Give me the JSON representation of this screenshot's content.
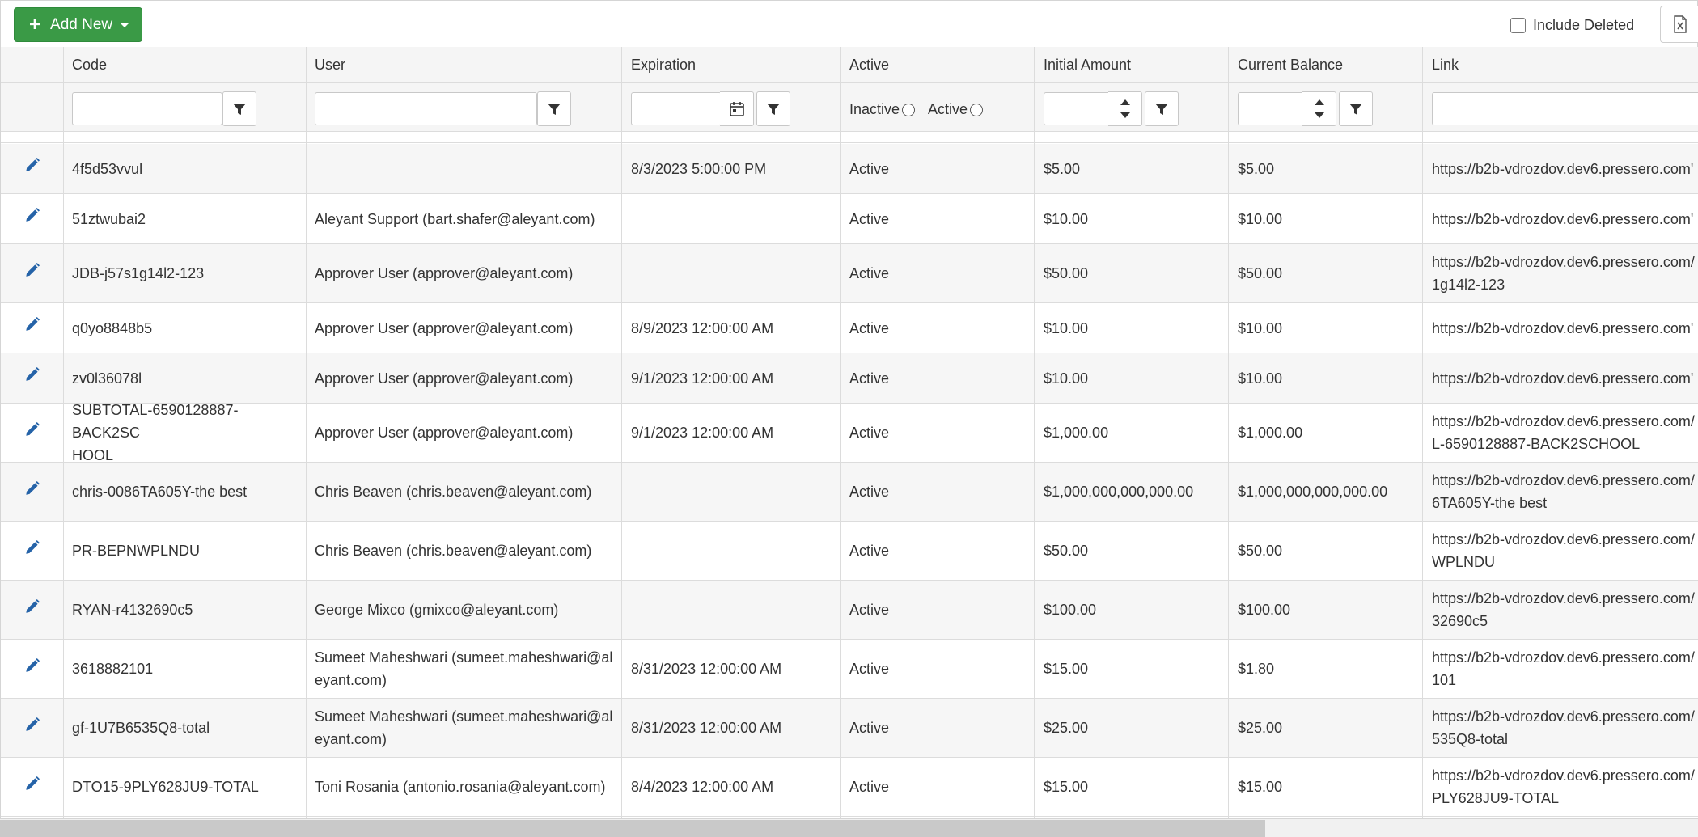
{
  "toolbar": {
    "add_new_label": "Add New",
    "include_deleted_label": "Include Deleted"
  },
  "colors": {
    "add_button": "#3a9a46",
    "pencil": "#2563a8",
    "row_alt": "#f6f6f6"
  },
  "headers": {
    "code": "Code",
    "user": "User",
    "expiration": "Expiration",
    "active": "Active",
    "initial_amount": "Initial Amount",
    "current_balance": "Current Balance",
    "link": "Link"
  },
  "filters": {
    "inactive_label": "Inactive",
    "active_label": "Active"
  },
  "rows": [
    {
      "code": "4f5d53vvul",
      "user": "",
      "expiration": "8/3/2023 5:00:00 PM",
      "active": "Active",
      "initial": "$5.00",
      "balance": "$5.00",
      "link": "https://b2b-vdrozdov.dev6.pressero.com'"
    },
    {
      "code": "51ztwubai2",
      "user": "Aleyant Support (bart.shafer@aleyant.com)",
      "expiration": "",
      "active": "Active",
      "initial": "$10.00",
      "balance": "$10.00",
      "link": "https://b2b-vdrozdov.dev6.pressero.com'"
    },
    {
      "code": "JDB-j57s1g14l2-123",
      "user": "Approver User (approver@aleyant.com)",
      "expiration": "",
      "active": "Active",
      "initial": "$50.00",
      "balance": "$50.00",
      "link": "https://b2b-vdrozdov.dev6.pressero.com/\n1g14l2-123"
    },
    {
      "code": "q0yo8848b5",
      "user": "Approver User (approver@aleyant.com)",
      "expiration": "8/9/2023 12:00:00 AM",
      "active": "Active",
      "initial": "$10.00",
      "balance": "$10.00",
      "link": "https://b2b-vdrozdov.dev6.pressero.com'"
    },
    {
      "code": "zv0l36078l",
      "user": "Approver User (approver@aleyant.com)",
      "expiration": "9/1/2023 12:00:00 AM",
      "active": "Active",
      "initial": "$10.00",
      "balance": "$10.00",
      "link": "https://b2b-vdrozdov.dev6.pressero.com'"
    },
    {
      "code": "SUBTOTAL-6590128887-BACK2SC\nHOOL",
      "user": "Approver User (approver@aleyant.com)",
      "expiration": "9/1/2023 12:00:00 AM",
      "active": "Active",
      "initial": "$1,000.00",
      "balance": "$1,000.00",
      "link": "https://b2b-vdrozdov.dev6.pressero.com/\nL-6590128887-BACK2SCHOOL"
    },
    {
      "code": "chris-0086TA605Y-the best",
      "user": "Chris Beaven (chris.beaven@aleyant.com)",
      "expiration": "",
      "active": "Active",
      "initial": "$1,000,000,000,000.00",
      "balance": "$1,000,000,000,000.00",
      "link": "https://b2b-vdrozdov.dev6.pressero.com/\n6TA605Y-the best"
    },
    {
      "code": "PR-BEPNWPLNDU",
      "user": "Chris Beaven (chris.beaven@aleyant.com)",
      "expiration": "",
      "active": "Active",
      "initial": "$50.00",
      "balance": "$50.00",
      "link": "https://b2b-vdrozdov.dev6.pressero.com/\nWPLNDU"
    },
    {
      "code": "RYAN-r4132690c5",
      "user": "George Mixco (gmixco@aleyant.com)",
      "expiration": "",
      "active": "Active",
      "initial": "$100.00",
      "balance": "$100.00",
      "link": "https://b2b-vdrozdov.dev6.pressero.com/\n32690c5"
    },
    {
      "code": "3618882101",
      "user": "Sumeet Maheshwari (sumeet.maheshwari@al\neyant.com)",
      "expiration": "8/31/2023 12:00:00 AM",
      "active": "Active",
      "initial": "$15.00",
      "balance": "$1.80",
      "link": "https://b2b-vdrozdov.dev6.pressero.com/\n101"
    },
    {
      "code": "gf-1U7B6535Q8-total",
      "user": "Sumeet Maheshwari (sumeet.maheshwari@al\neyant.com)",
      "expiration": "8/31/2023 12:00:00 AM",
      "active": "Active",
      "initial": "$25.00",
      "balance": "$25.00",
      "link": "https://b2b-vdrozdov.dev6.pressero.com/\n535Q8-total"
    },
    {
      "code": "DTO15-9PLY628JU9-TOTAL",
      "user": "Toni Rosania (antonio.rosania@aleyant.com)",
      "expiration": "8/4/2023 12:00:00 AM",
      "active": "Active",
      "initial": "$15.00",
      "balance": "$15.00",
      "link": "https://b2b-vdrozdov.dev6.pressero.com/\nPLY628JU9-TOTAL"
    }
  ]
}
